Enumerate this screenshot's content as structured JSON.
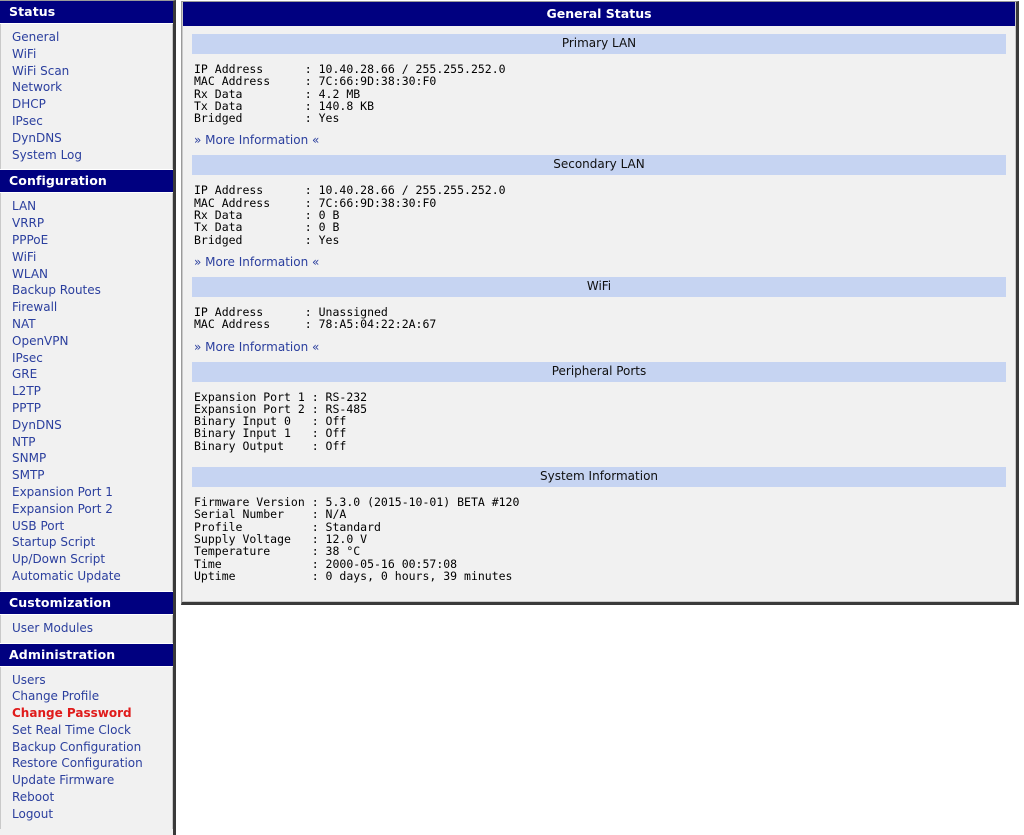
{
  "sidebar": {
    "groups": [
      {
        "title": "Status",
        "items": [
          {
            "label": "General",
            "current": false
          },
          {
            "label": "WiFi",
            "current": false
          },
          {
            "label": "WiFi Scan",
            "current": false
          },
          {
            "label": "Network",
            "current": false
          },
          {
            "label": "DHCP",
            "current": false
          },
          {
            "label": "IPsec",
            "current": false
          },
          {
            "label": "DynDNS",
            "current": false
          },
          {
            "label": "System Log",
            "current": false
          }
        ]
      },
      {
        "title": "Configuration",
        "items": [
          {
            "label": "LAN",
            "current": false
          },
          {
            "label": "VRRP",
            "current": false
          },
          {
            "label": "PPPoE",
            "current": false
          },
          {
            "label": "WiFi",
            "current": false
          },
          {
            "label": "WLAN",
            "current": false
          },
          {
            "label": "Backup Routes",
            "current": false
          },
          {
            "label": "Firewall",
            "current": false
          },
          {
            "label": "NAT",
            "current": false
          },
          {
            "label": "OpenVPN",
            "current": false
          },
          {
            "label": "IPsec",
            "current": false
          },
          {
            "label": "GRE",
            "current": false
          },
          {
            "label": "L2TP",
            "current": false
          },
          {
            "label": "PPTP",
            "current": false
          },
          {
            "label": "DynDNS",
            "current": false
          },
          {
            "label": "NTP",
            "current": false
          },
          {
            "label": "SNMP",
            "current": false
          },
          {
            "label": "SMTP",
            "current": false
          },
          {
            "label": "Expansion Port 1",
            "current": false
          },
          {
            "label": "Expansion Port 2",
            "current": false
          },
          {
            "label": "USB Port",
            "current": false
          },
          {
            "label": "Startup Script",
            "current": false
          },
          {
            "label": "Up/Down Script",
            "current": false
          },
          {
            "label": "Automatic Update",
            "current": false
          }
        ]
      },
      {
        "title": "Customization",
        "items": [
          {
            "label": "User Modules",
            "current": false
          }
        ]
      },
      {
        "title": "Administration",
        "items": [
          {
            "label": "Users",
            "current": false
          },
          {
            "label": "Change Profile",
            "current": false
          },
          {
            "label": "Change Password",
            "current": true
          },
          {
            "label": "Set Real Time Clock",
            "current": false
          },
          {
            "label": "Backup Configuration",
            "current": false
          },
          {
            "label": "Restore Configuration",
            "current": false
          },
          {
            "label": "Update Firmware",
            "current": false
          },
          {
            "label": "Reboot",
            "current": false
          },
          {
            "label": "Logout",
            "current": false
          }
        ]
      }
    ]
  },
  "content": {
    "title": "General Status",
    "more_link_label": "» More Information «",
    "sections": [
      {
        "heading": "Primary LAN",
        "body": "IP Address      : 10.40.28.66 / 255.255.252.0\nMAC Address     : 7C:66:9D:38:30:F0\nRx Data         : 4.2 MB\nTx Data         : 140.8 KB\nBridged         : Yes",
        "has_more": true
      },
      {
        "heading": "Secondary LAN",
        "body": "IP Address      : 10.40.28.66 / 255.255.252.0\nMAC Address     : 7C:66:9D:38:30:F0\nRx Data         : 0 B\nTx Data         : 0 B\nBridged         : Yes",
        "has_more": true
      },
      {
        "heading": "WiFi",
        "body": "IP Address      : Unassigned\nMAC Address     : 78:A5:04:22:2A:67",
        "has_more": true
      },
      {
        "heading": "Peripheral Ports",
        "body": "Expansion Port 1 : RS-232\nExpansion Port 2 : RS-485\nBinary Input 0   : Off\nBinary Input 1   : Off\nBinary Output    : Off",
        "has_more": false
      },
      {
        "heading": "System Information",
        "body": "Firmware Version : 5.3.0 (2015-10-01) BETA #120\nSerial Number    : N/A\nProfile          : Standard\nSupply Voltage   : 12.0 V\nTemperature      : 38 °C\nTime             : 2000-05-16 00:57:08\nUptime           : 0 days, 0 hours, 39 minutes",
        "has_more": false
      }
    ]
  },
  "colors": {
    "nav_header_bg": "#000080",
    "section_header_bg": "#c6d4f2",
    "link": "#2b3f9e",
    "current_link": "#e01b1b",
    "panel_bg": "#f1f1f1"
  }
}
